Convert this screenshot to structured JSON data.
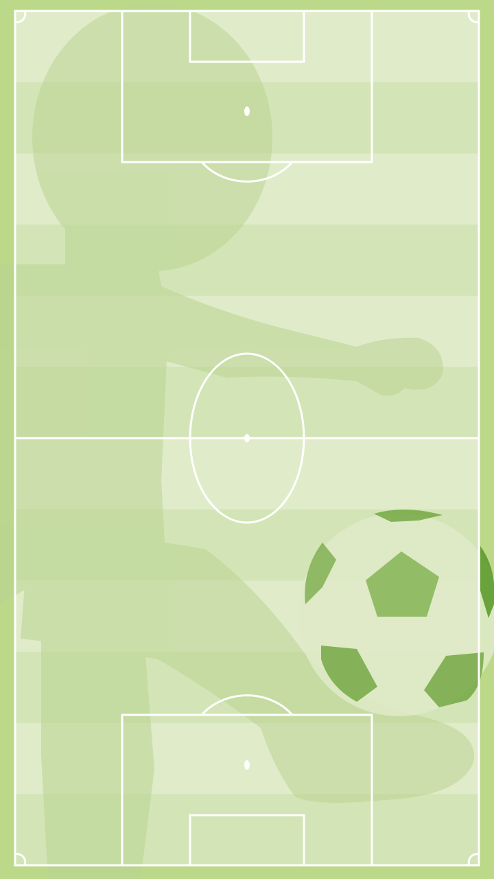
{
  "colors": {
    "border": "#bcd98a",
    "stripe_light": "#e0ebc9",
    "stripe_dark": "#d3e4b6",
    "figure": "#c7dda6",
    "figure_shadow": "#b9d492",
    "ball_light": "#dfeac8",
    "ball_patch": "#80b04f",
    "ball_patch_dark": "#5d9a2c",
    "lines": "#ffffff"
  },
  "scene": {
    "background": "mascot-figure-kicking-ball",
    "pitch": "football-pitch-portrait",
    "stripe_count": 12
  }
}
